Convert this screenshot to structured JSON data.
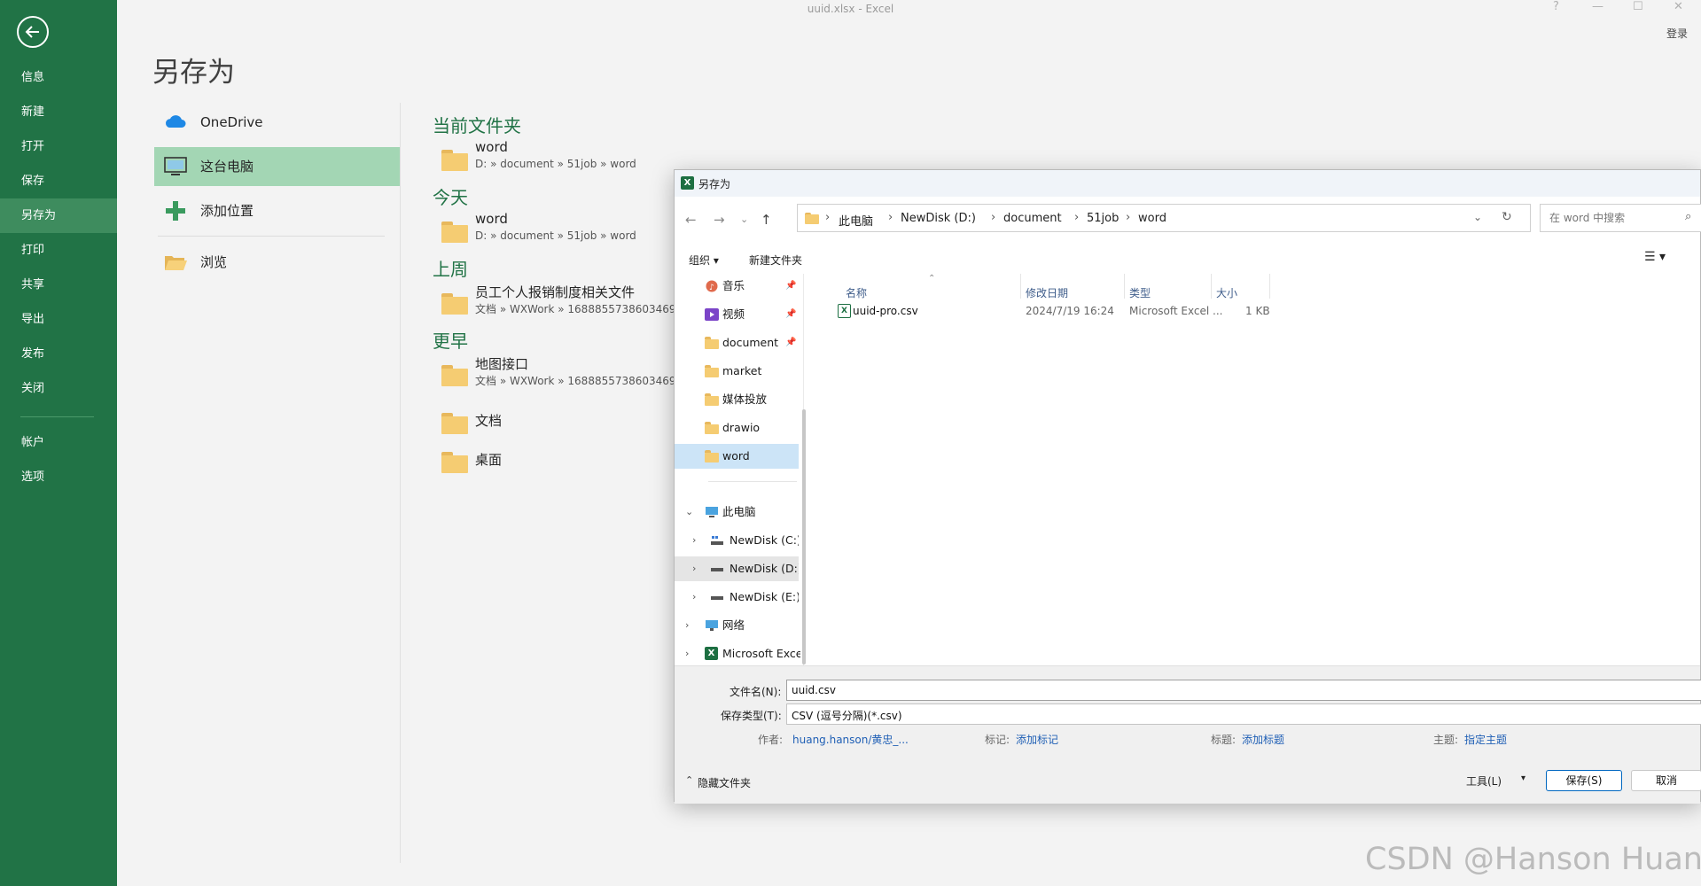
{
  "window": {
    "title": "uuid.xlsx - Excel",
    "login": "登录",
    "help": "?",
    "min": "—",
    "max": "☐",
    "close": "✕"
  },
  "nav": {
    "items": [
      {
        "label": "信息"
      },
      {
        "label": "新建"
      },
      {
        "label": "打开"
      },
      {
        "label": "保存"
      },
      {
        "label": "另存为"
      },
      {
        "label": "打印"
      },
      {
        "label": "共享"
      },
      {
        "label": "导出"
      },
      {
        "label": "发布"
      },
      {
        "label": "关闭"
      }
    ],
    "bottom_items": [
      {
        "label": "帐户"
      },
      {
        "label": "选项"
      }
    ]
  },
  "backstage": {
    "title": "另存为",
    "locations": [
      {
        "label": "OneDrive",
        "icon": "onedrive-cloud-icon"
      },
      {
        "label": "这台电脑",
        "icon": "computer-icon"
      },
      {
        "label": "添加位置",
        "icon": "plus-icon"
      },
      {
        "label": "浏览",
        "icon": "open-folder-icon"
      }
    ],
    "groups": [
      {
        "title": "当前文件夹",
        "items": [
          {
            "name": "word",
            "path": "D: » document » 51job » word"
          }
        ]
      },
      {
        "title": "今天",
        "items": [
          {
            "name": "word",
            "path": "D: » document » 51job » word"
          }
        ]
      },
      {
        "title": "上周",
        "items": [
          {
            "name": "员工个人报销制度相关文件",
            "path": "文档 » WXWork » 1688855738603469"
          }
        ]
      },
      {
        "title": "更早",
        "items": [
          {
            "name": "地图接口",
            "path": "文档 » WXWork » 1688855738603469"
          }
        ]
      }
    ],
    "extra_folders": [
      {
        "name": "文档"
      },
      {
        "name": "桌面"
      }
    ]
  },
  "dialog": {
    "title": "另存为",
    "breadcrumb": [
      "此电脑",
      "NewDisk (D:)",
      "document",
      "51job",
      "word"
    ],
    "search_placeholder": "在 word 中搜索",
    "toolbar": {
      "organize": "组织 ▾",
      "new_folder": "新建文件夹"
    },
    "tree": [
      {
        "label": "音乐",
        "icon": "music-icon",
        "pinned": true
      },
      {
        "label": "视频",
        "icon": "video-icon",
        "pinned": true
      },
      {
        "label": "document",
        "icon": "folder-icon",
        "pinned": true
      },
      {
        "label": "market",
        "icon": "folder-icon"
      },
      {
        "label": "媒体投放",
        "icon": "folder-icon"
      },
      {
        "label": "drawio",
        "icon": "folder-icon"
      },
      {
        "label": "word",
        "icon": "folder-icon",
        "selected": true
      }
    ],
    "tree_pc": [
      {
        "label": "此电脑",
        "icon": "computer-icon",
        "expanded": true
      },
      {
        "label": "NewDisk (C:)",
        "icon": "drive-icon"
      },
      {
        "label": "NewDisk (D:)",
        "icon": "drive-icon",
        "highlighted": true
      },
      {
        "label": "NewDisk (E:)",
        "icon": "drive-icon"
      },
      {
        "label": "网络",
        "icon": "network-icon"
      },
      {
        "label": "Microsoft Excel",
        "icon": "excel-icon"
      }
    ],
    "columns": [
      "名称",
      "修改日期",
      "类型",
      "大小"
    ],
    "files": [
      {
        "name": "uuid-pro.csv",
        "modified": "2024/7/19 16:24",
        "type": "Microsoft Excel ...",
        "size": "1 KB"
      }
    ],
    "filename_label": "文件名(N):",
    "filename": "uuid.csv",
    "filetype_label": "保存类型(T):",
    "filetype": "CSV (逗号分隔)(*.csv)",
    "meta": {
      "author_label": "作者:",
      "author": "huang.hanson/黄忠_...",
      "tags_label": "标记:",
      "tags": "添加标记",
      "title_label": "标题:",
      "title": "添加标题",
      "subject_label": "主题:",
      "subject": "指定主题"
    },
    "hide_folders": "隐藏文件夹",
    "tools": "工具(L)",
    "save": "保存(S)",
    "cancel": "取消"
  },
  "watermark": "CSDN @Hanson Huang",
  "colors": {
    "excel_green": "#217346",
    "active_location": "#a3d6b4",
    "link_blue": "#1f5fb5"
  }
}
